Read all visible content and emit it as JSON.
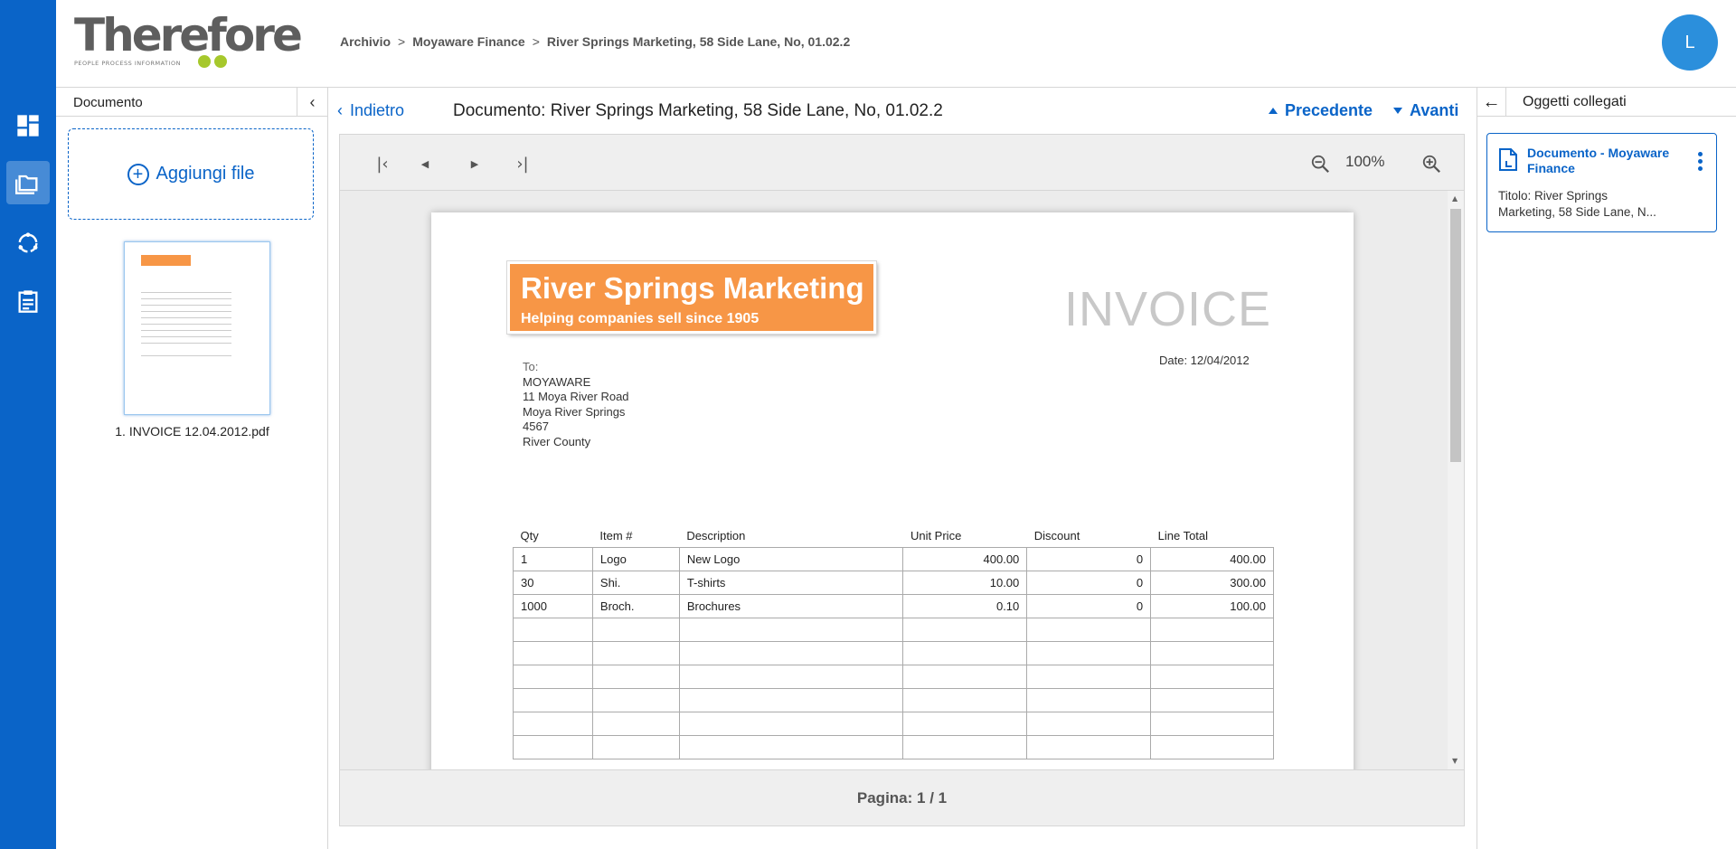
{
  "app": {
    "logo_text": "Therefore",
    "logo_tagline": "PEOPLE   PROCESS   INFORMATION",
    "avatar_initial": "L"
  },
  "breadcrumb": [
    "Archivio",
    "Moyaware Finance",
    "River Springs Marketing, 58 Side Lane, No, 01.02.2"
  ],
  "left_panel": {
    "title": "Documento",
    "add_file_label": "Aggiungi file",
    "file_name": "1. INVOICE 12.04.2012.pdf"
  },
  "doc_header": {
    "back_label": "Indietro",
    "title": "Documento: River Springs Marketing, 58 Side Lane, No, 01.02.2",
    "prev_label": "Precedente",
    "next_label": "Avanti"
  },
  "viewer": {
    "zoom": "100%",
    "pager": "Pagina: 1 / 1"
  },
  "invoice": {
    "company": "River Springs Marketing",
    "tagline": "Helping companies sell since 1905",
    "heading": "INVOICE",
    "date": "Date: 12/04/2012",
    "to_label": "To:",
    "to_lines": [
      "MOYAWARE",
      "11 Moya River Road",
      "Moya River Springs",
      "4567",
      "River County"
    ],
    "columns": [
      "Qty",
      "Item #",
      "Description",
      "Unit Price",
      "Discount",
      "Line Total"
    ],
    "rows": [
      [
        "1",
        "Logo",
        "New Logo",
        "400.00",
        "0",
        "400.00"
      ],
      [
        "30",
        "Shi.",
        "T-shirts",
        "10.00",
        "0",
        "300.00"
      ],
      [
        "1000",
        "Broch.",
        "Brochures",
        "0.10",
        "0",
        "100.00"
      ]
    ]
  },
  "right_panel": {
    "title": "Oggetti collegati",
    "card_title": "Documento - Moyaware Finance",
    "card_subtitle": "Titolo: River Springs Marketing, 58 Side Lane, N..."
  },
  "colors": {
    "accent": "#0a64c8",
    "brand_orange": "#f79646",
    "logo_green": "#a6c82c"
  }
}
